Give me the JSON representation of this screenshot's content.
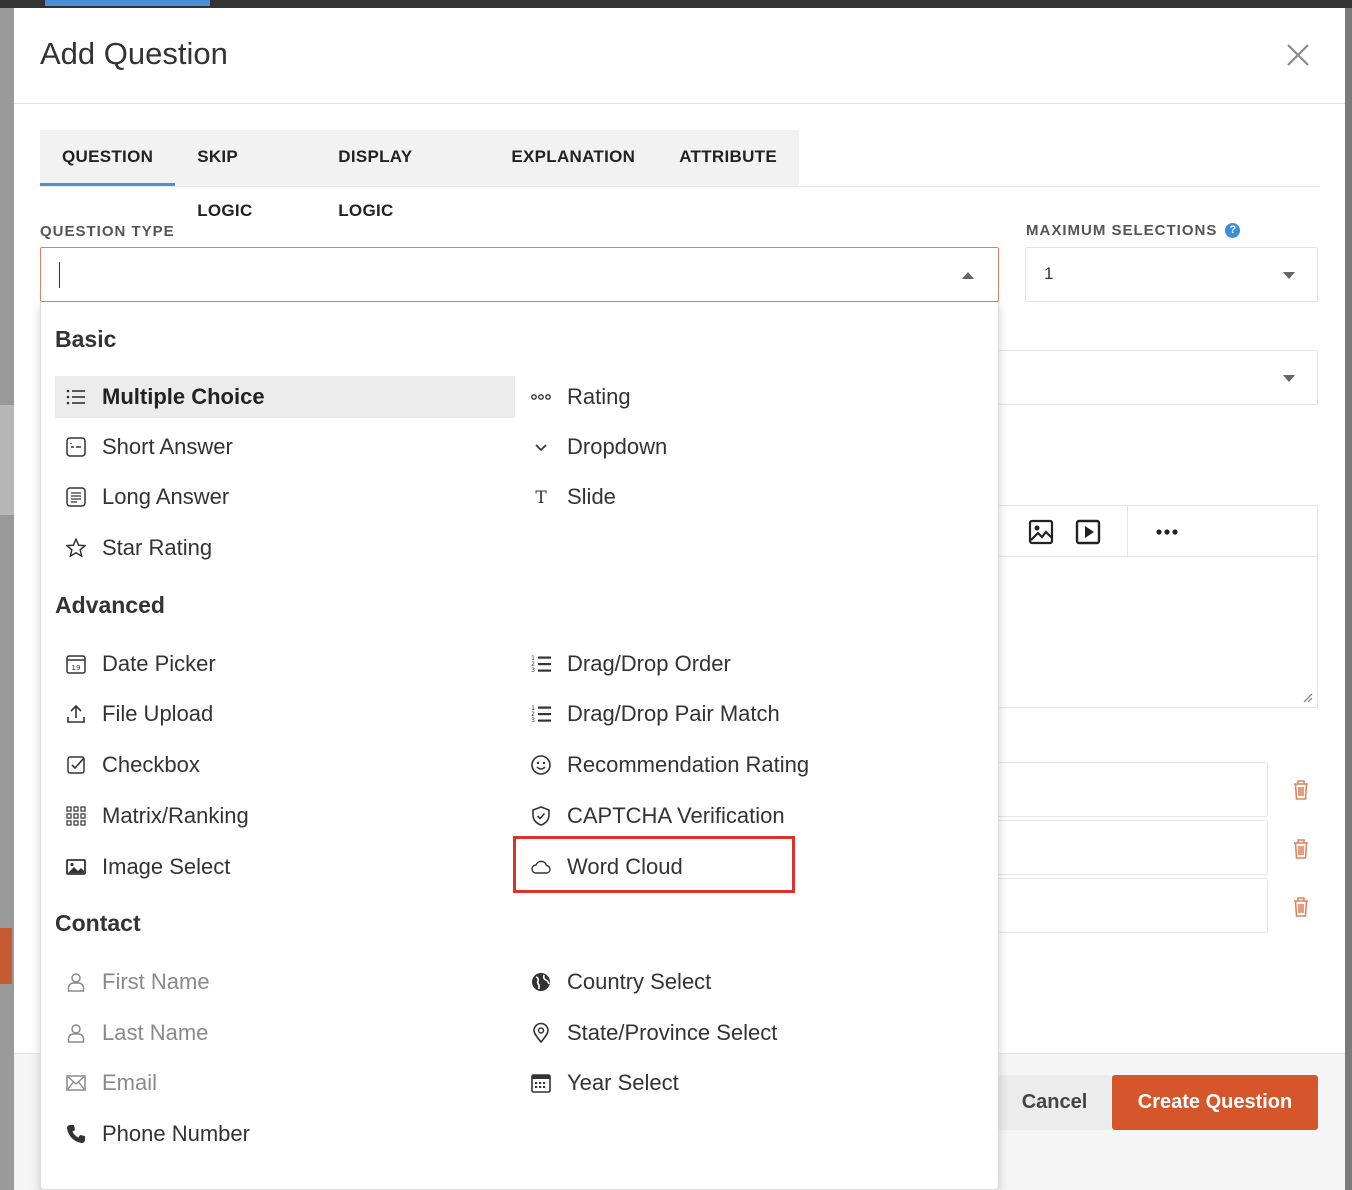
{
  "modal": {
    "title": "Add Question"
  },
  "tabs": [
    {
      "label": "QUESTION",
      "active": true
    },
    {
      "label": "SKIP LOGIC",
      "active": false
    },
    {
      "label": "DISPLAY LOGIC",
      "active": false
    },
    {
      "label": "EXPLANATION",
      "active": false
    },
    {
      "label": "ATTRIBUTE",
      "active": false
    }
  ],
  "question_type": {
    "label": "QUESTION TYPE",
    "value": ""
  },
  "max_selections": {
    "label": "MAXIMUM SELECTIONS",
    "help": "?",
    "value": "1"
  },
  "dropdown": {
    "groups": [
      {
        "title": "Basic"
      },
      {
        "title": "Advanced"
      },
      {
        "title": "Contact"
      }
    ],
    "basic": [
      {
        "label": "Multiple Choice",
        "icon": "list-icon",
        "selected": true
      },
      {
        "label": "Rating",
        "icon": "dots-icon"
      },
      {
        "label": "Short Answer",
        "icon": "short-answer-icon"
      },
      {
        "label": "Dropdown",
        "icon": "chevron-down-icon"
      },
      {
        "label": "Long Answer",
        "icon": "long-answer-icon"
      },
      {
        "label": "Slide",
        "icon": "text-t-icon"
      },
      {
        "label": "Star Rating",
        "icon": "star-icon"
      }
    ],
    "advanced": [
      {
        "label": "Date Picker",
        "icon": "calendar-icon"
      },
      {
        "label": "Drag/Drop Order",
        "icon": "ordered-list-icon"
      },
      {
        "label": "File Upload",
        "icon": "upload-icon"
      },
      {
        "label": "Drag/Drop Pair Match",
        "icon": "ordered-list-icon"
      },
      {
        "label": "Checkbox",
        "icon": "checkbox-icon"
      },
      {
        "label": "Recommendation Rating",
        "icon": "smiley-icon"
      },
      {
        "label": "Matrix/Ranking",
        "icon": "grid-icon"
      },
      {
        "label": "CAPTCHA Verification",
        "icon": "shield-check-icon"
      },
      {
        "label": "Image Select",
        "icon": "image-icon"
      },
      {
        "label": "Word Cloud",
        "icon": "cloud-icon",
        "highlighted": true
      }
    ],
    "contact": [
      {
        "label": "First Name",
        "icon": "user-icon",
        "muted": true
      },
      {
        "label": "Country Select",
        "icon": "globe-icon"
      },
      {
        "label": "Last Name",
        "icon": "user-icon",
        "muted": true
      },
      {
        "label": "State/Province Select",
        "icon": "location-pin-icon"
      },
      {
        "label": "Email",
        "icon": "envelope-icon",
        "muted": true
      },
      {
        "label": "Year Select",
        "icon": "calendar-grid-icon"
      },
      {
        "label": "Phone Number",
        "icon": "phone-icon"
      }
    ]
  },
  "footer": {
    "cancel": "Cancel",
    "create": "Create Question"
  },
  "colors": {
    "accent": "#4a90d9",
    "primary_button": "#d5562a",
    "highlight": "#e0302a",
    "input_focus": "#e0835d"
  }
}
